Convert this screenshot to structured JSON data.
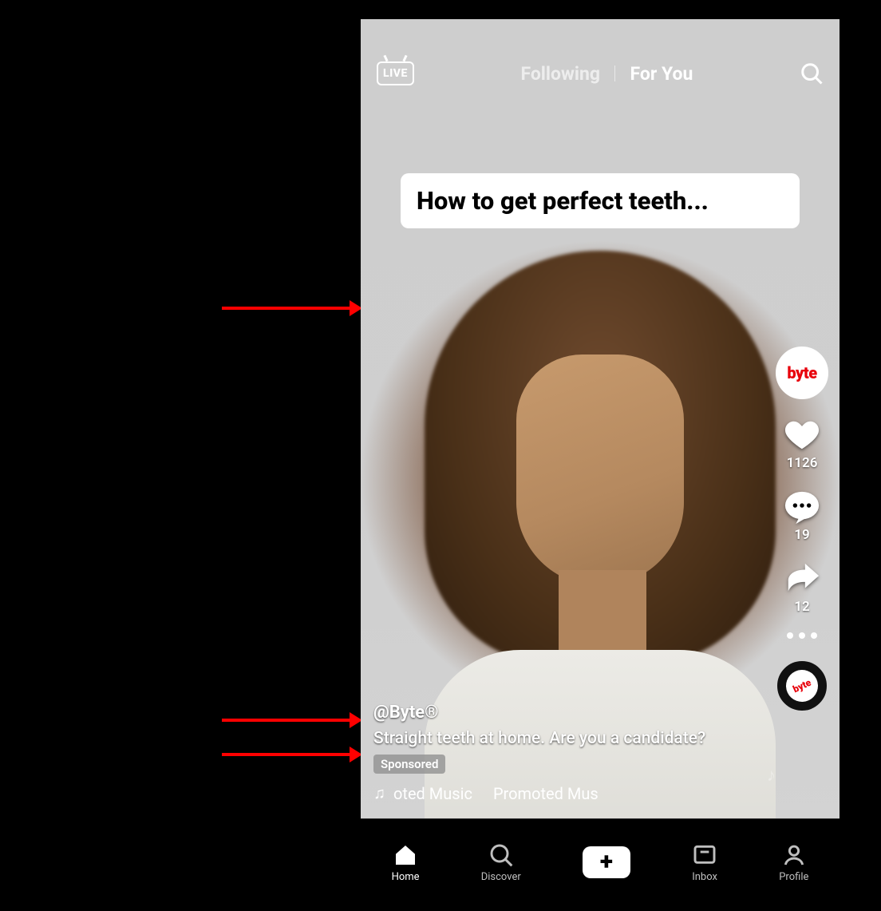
{
  "header": {
    "live_label": "LIVE",
    "tab_following": "Following",
    "tab_for_you": "For You"
  },
  "overlay": {
    "caption": "How to get perfect teeth..."
  },
  "rail": {
    "avatar_text": "byte",
    "like_count": "1126",
    "comment_count": "19",
    "share_count": "12",
    "record_text": "byte"
  },
  "info": {
    "handle": "@Byte®",
    "description": "Straight teeth at home.  Are you a candidate?",
    "sponsored_label": "Sponsored",
    "music_segment_a": "oted Music",
    "music_segment_b": "Promoted Mus"
  },
  "nav": {
    "home": "Home",
    "discover": "Discover",
    "inbox": "Inbox",
    "profile": "Profile"
  },
  "colors": {
    "annotation_arrow": "#ff0000",
    "tiktok_cyan": "#25F4EE",
    "tiktok_pink": "#FE2C55"
  }
}
